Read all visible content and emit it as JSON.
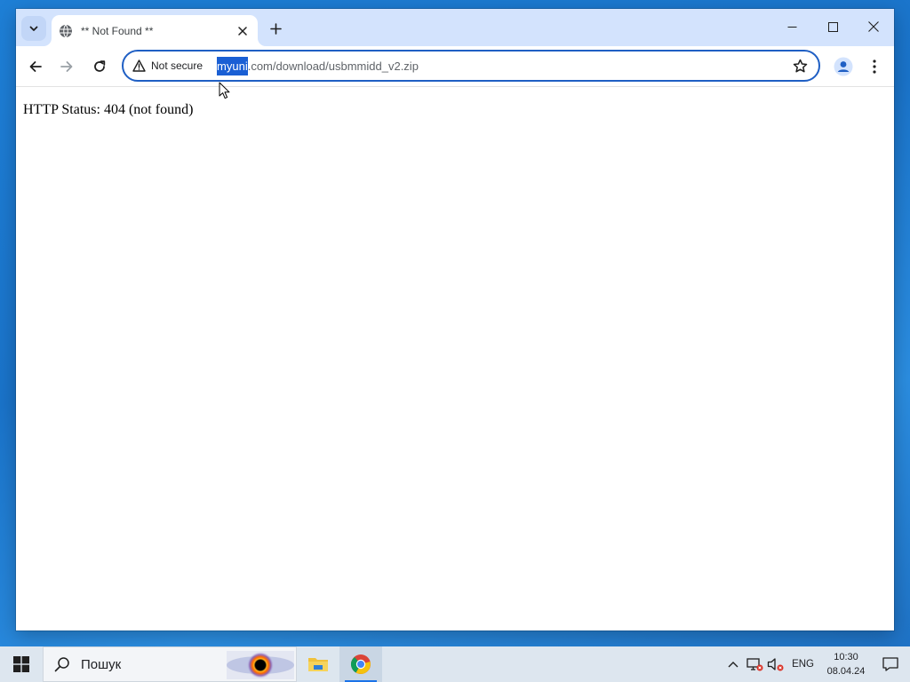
{
  "browser": {
    "tab": {
      "title": "** Not Found **",
      "favicon": "globe-icon"
    },
    "new_tab_icon": "plus-icon",
    "tab_search_icon": "chevron-down-icon",
    "window_controls": [
      "minimize-icon",
      "maximize-icon",
      "close-icon"
    ],
    "toolbar": {
      "back_icon": "arrow-left-icon",
      "forward_icon": "arrow-right-icon",
      "reload_icon": "reload-icon",
      "security_label": "Not secure",
      "security_icon": "warning-triangle-icon",
      "url_selected": "myuni",
      "url_rest": ".com/download/usbmmidd_v2.zip",
      "bookmark_icon": "star-icon",
      "profile_icon": "profile-icon",
      "menu_icon": "kebab-menu-icon"
    }
  },
  "page": {
    "status_text": "HTTP Status: 404 (not found)"
  },
  "taskbar": {
    "search_placeholder": "Пошук",
    "apps": [
      "file-explorer-icon",
      "chrome-icon"
    ],
    "tray": {
      "language": "ENG",
      "time": "10:30",
      "date": "08.04.24"
    }
  },
  "colors": {
    "tabstrip_bg": "#d3e3fd",
    "omnibox_border": "#1f5fc4",
    "selection": "#1a5fd4",
    "desktop": "#1e7fd6"
  }
}
